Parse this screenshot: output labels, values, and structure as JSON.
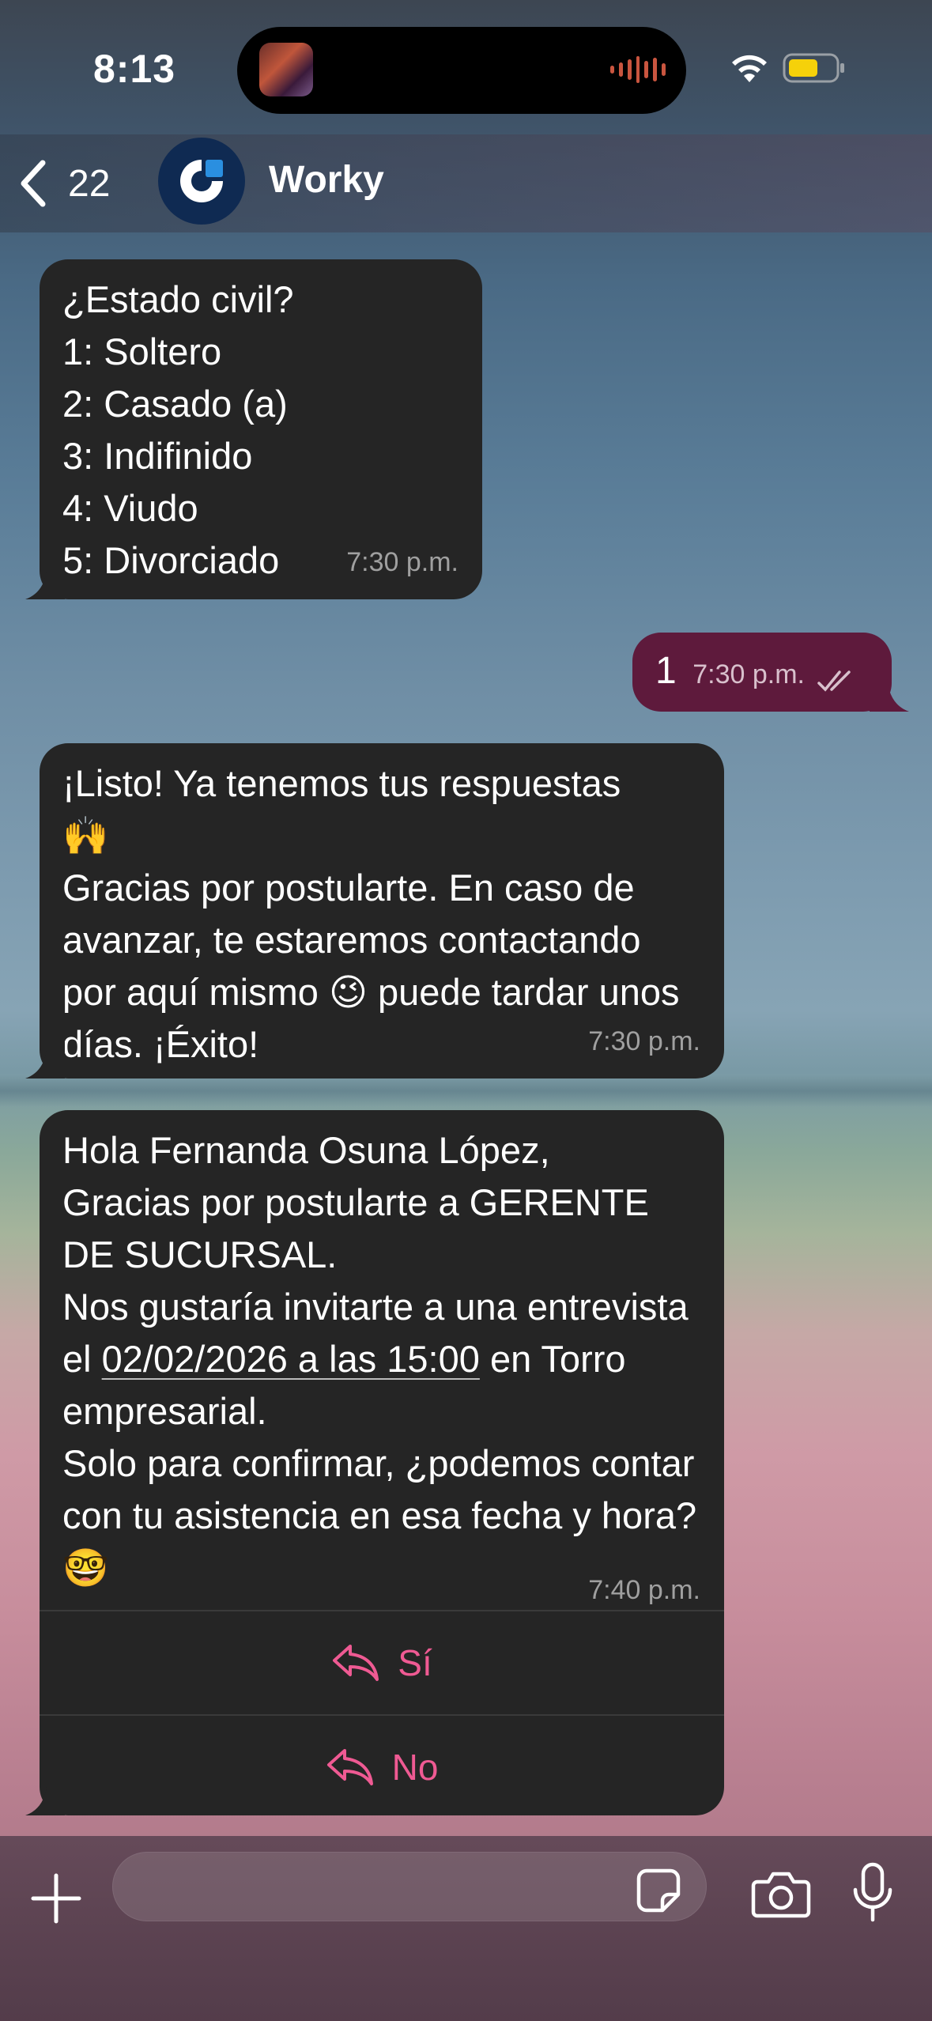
{
  "status_bar": {
    "time": "8:13"
  },
  "header": {
    "back_count": "22",
    "contact_name": "Worky"
  },
  "messages": [
    {
      "id": "m1",
      "direction": "in",
      "text": "¿Estado civil?\n1: Soltero\n2: Casado (a)\n3: Indifinido\n4: Viudo\n5: Divorciado",
      "time": "7:30 p.m."
    },
    {
      "id": "m2",
      "direction": "out",
      "text": "1",
      "time": "7:30 p.m."
    },
    {
      "id": "m3",
      "direction": "in",
      "text_line1": "¡Listo! Ya tenemos tus respuestas",
      "emoji1": "🙌",
      "text_line2": "Gracias por postularte. En caso de avanzar, te estaremos contactando por aquí mismo",
      "emoji2": "😉",
      "text_line3": "puede tardar unos días. ¡Éxito!",
      "time": "7:30 p.m."
    },
    {
      "id": "m4",
      "direction": "in",
      "p1": "Hola Fernanda Osuna López,\nGracias por postularte a GERENTE DE SUCURSAL.\nNos gustaría invitarte a una entrevista el ",
      "link": "02/02/2026 a las 15:00",
      "p2": " en Torro empresarial.\nSolo para confirmar, ¿podemos contar con tu asistencia en esa fecha y hora?",
      "emoji": "🤓",
      "time": "7:40 p.m.",
      "buttons": [
        "Sí",
        "No"
      ]
    }
  ],
  "composer": {
    "placeholder": ""
  },
  "colors": {
    "incoming_bubble": "#252525",
    "outgoing_bubble": "#5e1a3c",
    "quick_reply": "#ef5a93"
  }
}
